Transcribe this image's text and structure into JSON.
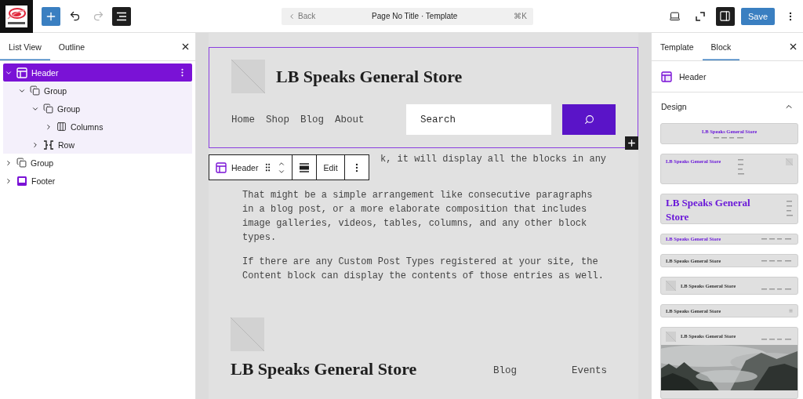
{
  "top_bar": {
    "undo": {
      "disabled": false
    },
    "redo": {
      "disabled": true
    },
    "list_view": {
      "active": true
    },
    "command": {
      "back": "Back",
      "title": "Page No Title · Template",
      "shortcut": "⌘K"
    },
    "settings": {
      "active": true
    },
    "save": "Save"
  },
  "left_panel": {
    "tabs": [
      {
        "label": "List View",
        "selected": true
      },
      {
        "label": "Outline",
        "selected": false
      }
    ],
    "tree": [
      {
        "label": "Header",
        "kind": "header-part",
        "selected": true,
        "expanded": true,
        "children": [
          {
            "label": "Group",
            "kind": "group",
            "selected": false,
            "expanded": true,
            "children": [
              {
                "label": "Group",
                "kind": "group",
                "selected": false,
                "expanded": true,
                "children": [
                  {
                    "label": "Columns",
                    "kind": "columns",
                    "selected": false,
                    "expanded": false
                  }
                ]
              },
              {
                "label": "Row",
                "kind": "row",
                "selected": false,
                "expanded": false
              }
            ]
          }
        ]
      },
      {
        "label": "Group",
        "kind": "group",
        "selected": false,
        "expanded": false
      },
      {
        "label": "Footer",
        "kind": "footer-part",
        "selected": false,
        "expanded": false
      }
    ]
  },
  "canvas": {
    "header_block": {
      "selected": true,
      "site_title": "LB Speaks General Store",
      "nav": [
        "Home",
        "Shop",
        "Blog",
        "About"
      ],
      "search": {
        "placeholder": "Search"
      }
    },
    "block_toolbar": {
      "block": "Header",
      "edit": "Edit"
    },
    "content_fragment": "k, it will display all the blocks in any",
    "paragraphs": [
      "That might be a simple arrangement like consecutive paragraphs in a blog post, or a more elaborate composition that includes image galleries, videos, tables, columns, and any other block types.",
      "If there are any Custom Post Types registered at your site, the Content block can display the contents of those entries as well."
    ],
    "footer": {
      "site_title": "LB Speaks General Store",
      "links": [
        "Blog",
        "Events"
      ]
    }
  },
  "right_panel": {
    "tabs": [
      {
        "label": "Template",
        "selected": false
      },
      {
        "label": "Block",
        "selected": true
      }
    ],
    "block": {
      "name": "Header"
    },
    "design": {
      "title": "Design",
      "expanded": true,
      "patterns": [
        {
          "kind": "centered",
          "title": "LB Speaks General Store"
        },
        {
          "kind": "stacked-nav",
          "title": "LB Speaks General Store"
        },
        {
          "kind": "large-title",
          "title": "LB Speaks General Store"
        },
        {
          "kind": "small-purple",
          "title": "LB Speaks General Store"
        },
        {
          "kind": "plain",
          "title": "LB Speaks General Store"
        },
        {
          "kind": "with-logo",
          "title": "LB Speaks General Store"
        },
        {
          "kind": "menu-icon",
          "title": "LB Speaks General Store"
        },
        {
          "kind": "with-picture",
          "title": "LB Speaks General Store"
        }
      ]
    }
  }
}
